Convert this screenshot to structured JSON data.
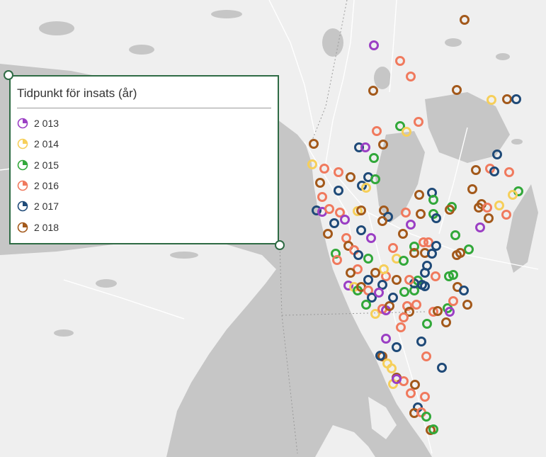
{
  "legend": {
    "title": "Tidpunkt för insats (år)",
    "items": [
      {
        "label": "2 013",
        "color": "#9b3fc4"
      },
      {
        "label": "2 014",
        "color": "#f6cf5a"
      },
      {
        "label": "2 015",
        "color": "#32a83a"
      },
      {
        "label": "2 016",
        "color": "#f07a5e"
      },
      {
        "label": "2 017",
        "color": "#1f4a78"
      },
      {
        "label": "2 018",
        "color": "#a3591b"
      }
    ]
  },
  "map": {
    "water_color": "#c6c6c6",
    "land_color": "#efefef"
  }
}
